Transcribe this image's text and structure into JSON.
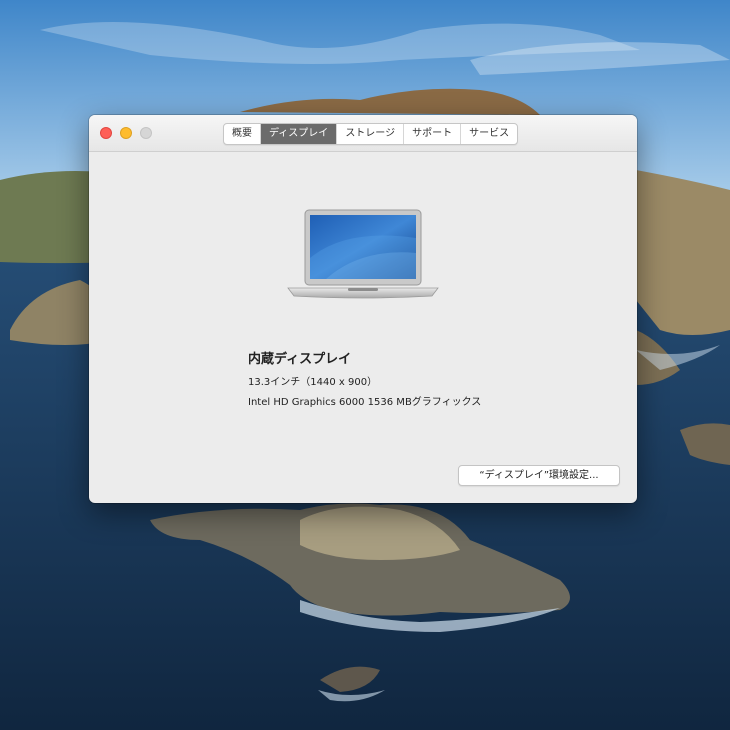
{
  "window": {
    "tabs": [
      {
        "label": "概要",
        "active": false
      },
      {
        "label": "ディスプレイ",
        "active": true
      },
      {
        "label": "ストレージ",
        "active": false
      },
      {
        "label": "サポート",
        "active": false
      },
      {
        "label": "サービス",
        "active": false
      }
    ]
  },
  "display": {
    "name": "内蔵ディスプレイ",
    "size": "13.3インチ（1440 x 900）",
    "graphics": "Intel HD Graphics 6000 1536 MBグラフィックス"
  },
  "buttons": {
    "display_prefs": "“ディスプレイ”環境設定..."
  },
  "icons": {
    "laptop": "macbook-air-icon"
  },
  "colors": {
    "close": "#fe5f57",
    "minimize": "#febc2e",
    "zoom_disabled": "#d6d6d6",
    "active_tab": "#6b6b6b"
  }
}
